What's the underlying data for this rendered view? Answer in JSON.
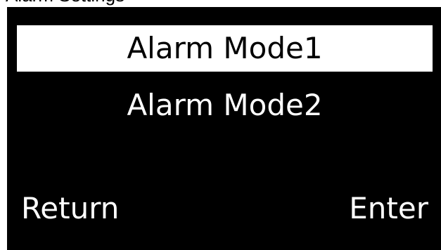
{
  "header": {
    "partial_text": "Alarm Settings"
  },
  "menu": {
    "items": [
      {
        "label": "Alarm Mode1",
        "selected": true
      },
      {
        "label": "Alarm Mode2",
        "selected": false
      }
    ]
  },
  "softkeys": {
    "return_label": "Return",
    "enter_label": "Enter"
  },
  "colors": {
    "screen_background": "#000000",
    "text": "#ffffff",
    "selection_highlight": "#ffffff",
    "selection_text": "#000000"
  }
}
